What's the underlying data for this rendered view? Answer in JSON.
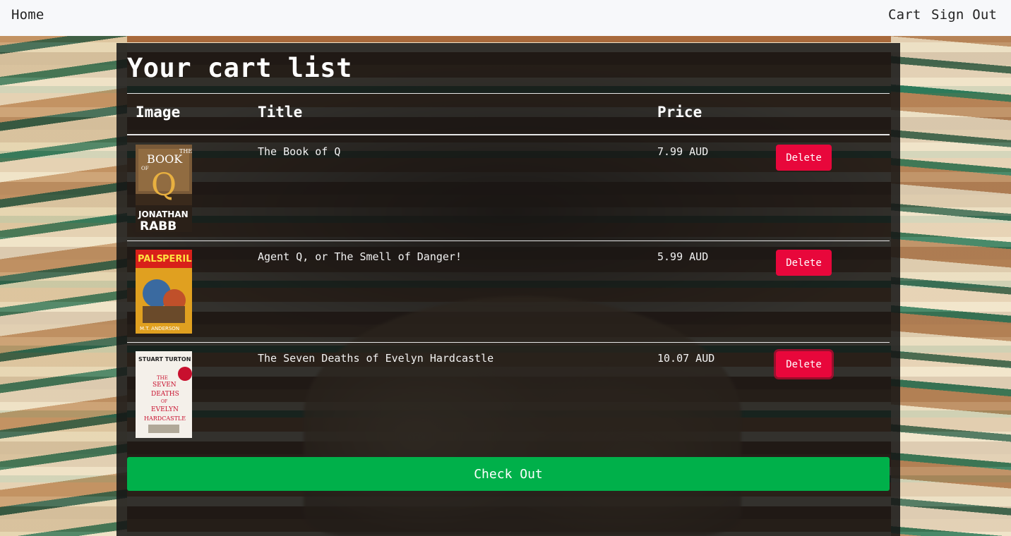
{
  "navbar": {
    "home": "Home",
    "cart": "Cart",
    "sign_out": "Sign Out"
  },
  "page": {
    "title": "Your cart list"
  },
  "table": {
    "headers": {
      "image": "Image",
      "title": "Title",
      "price": "Price"
    },
    "rows": [
      {
        "title": "The Book of Q",
        "price": "7.99 AUD",
        "delete_label": "Delete",
        "cover_text": [
          "THE",
          "BOOK",
          "OF",
          "Q",
          "JONATHAN",
          "RABB"
        ]
      },
      {
        "title": "Agent Q, or The Smell of Danger!",
        "price": "5.99 AUD",
        "delete_label": "Delete",
        "cover_text": [
          "PALS",
          "PERIL",
          "M.T. ANDERSON"
        ]
      },
      {
        "title": "The Seven Deaths of Evelyn Hardcastle",
        "price": "10.07 AUD",
        "delete_label": "Delete",
        "cover_text": [
          "STUART TURTON",
          "THE",
          "SEVEN",
          "DEATHS",
          "OF",
          "EVELYN",
          "HARDCASTLE"
        ]
      }
    ]
  },
  "checkout": {
    "label": "Check Out"
  },
  "colors": {
    "navbar_bg": "#f7f8fa",
    "panel_bg": "rgba(20,20,20,0.86)",
    "delete": "#e8073b",
    "checkout": "#00b04a"
  }
}
